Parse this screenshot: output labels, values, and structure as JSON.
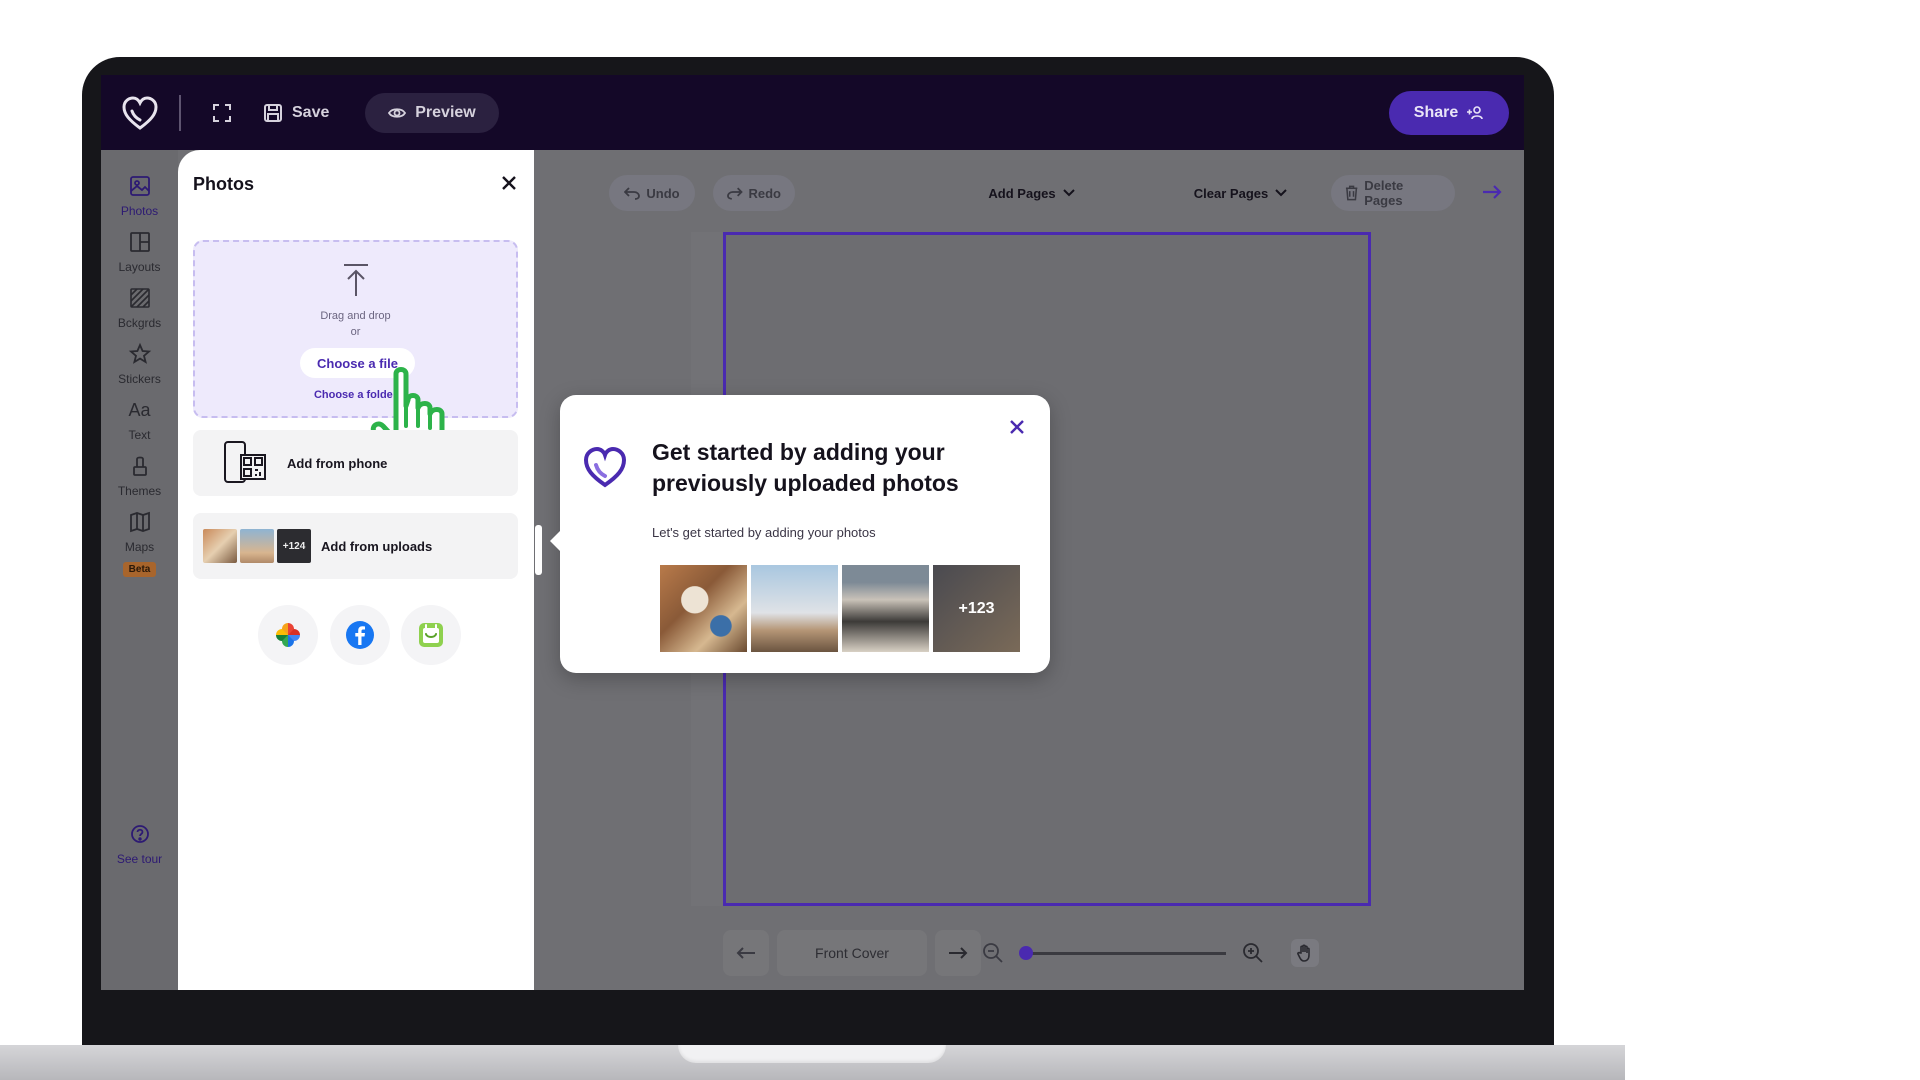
{
  "topbar": {
    "save_label": "Save",
    "preview_label": "Preview",
    "share_label": "Share"
  },
  "rail": {
    "items": [
      {
        "label": "Photos"
      },
      {
        "label": "Layouts"
      },
      {
        "label": "Bckgrds"
      },
      {
        "label": "Stickers"
      },
      {
        "label": "Text"
      },
      {
        "label": "Themes"
      },
      {
        "label": "Maps"
      }
    ],
    "beta_badge": "Beta",
    "text_icon_glyph": "Aa",
    "tour_label": "See tour"
  },
  "photos_panel": {
    "title": "Photos",
    "drag_text": "Drag and drop",
    "or_text": "or",
    "choose_file": "Choose a file",
    "choose_folder": "Choose a folder",
    "add_from_phone": "Add from phone",
    "add_from_uploads": "Add from uploads",
    "uploads_count_badge": "+124"
  },
  "editor_toolbar": {
    "undo": "Undo",
    "redo": "Redo",
    "add_pages": "Add Pages",
    "clear_pages": "Clear Pages",
    "delete_pages": "Delete Pages"
  },
  "bottom_nav": {
    "page_label": "Front Cover",
    "zoom_level": 0.0
  },
  "popup": {
    "title": "Get started by adding your previously uploaded photos",
    "subtitle": "Let's get started by adding your photos",
    "more_count": "+123"
  },
  "colors": {
    "brand": "#4a2ab0",
    "topbar_bg": "#140828",
    "cursor_green": "#2db34a"
  },
  "icons": {
    "logo": "heart-logo-icon",
    "expand": "expand-icon",
    "save": "save-icon",
    "preview": "eye-icon",
    "share": "add-user-icon",
    "close": "close-icon",
    "upload": "upload-arrow-icon",
    "pointer": "hand-pointer-icon",
    "phone": "phone-qr-icon",
    "google_photos": "google-photos-icon",
    "facebook": "facebook-icon",
    "third_service": "photo-service-icon",
    "hand_tool": "hand-tool-icon"
  }
}
